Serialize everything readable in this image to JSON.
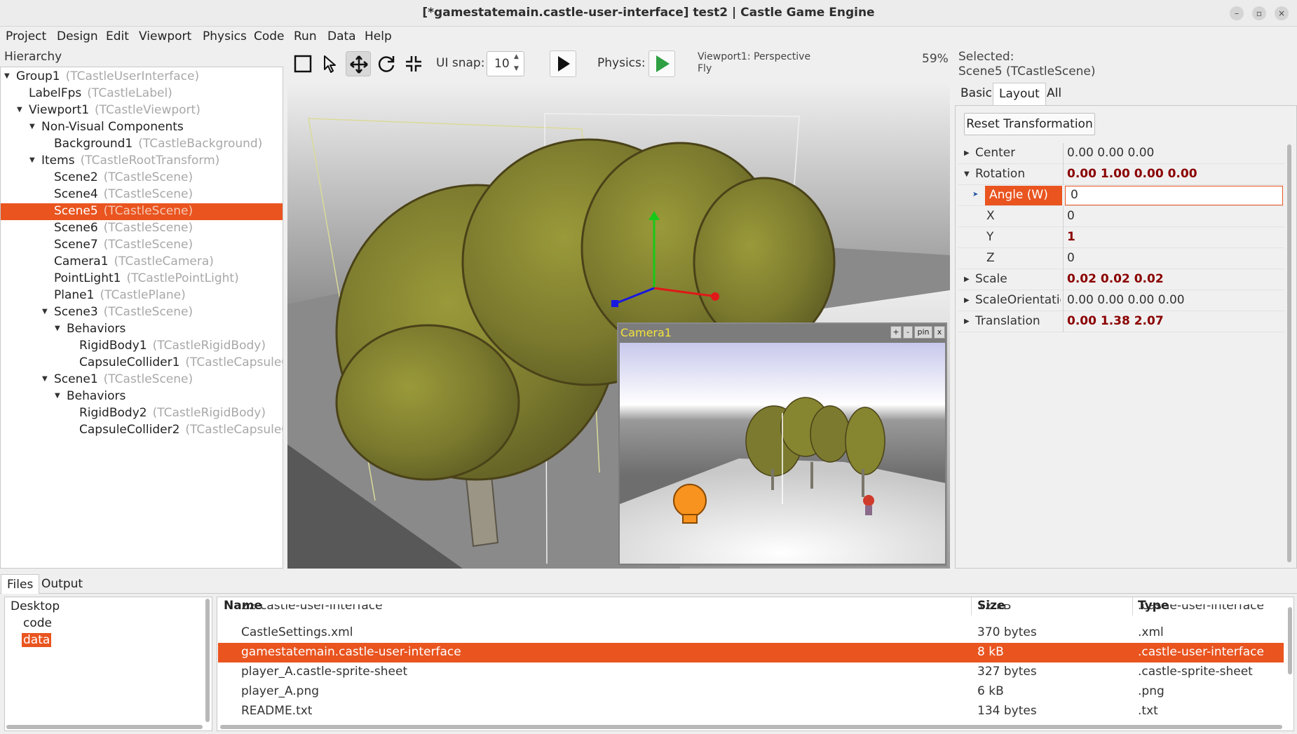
{
  "window": {
    "title": "[*gamestatemain.castle-user-interface] test2 | Castle Game Engine"
  },
  "menubar": [
    "Project",
    "Design",
    "Edit",
    "Viewport",
    "Physics",
    "Code",
    "Run",
    "Data",
    "Help"
  ],
  "hierarchy": {
    "label": "Hierarchy",
    "items": [
      {
        "name": "Group1",
        "cls": "(TCastleUserInterface)"
      },
      {
        "name": "LabelFps",
        "cls": "(TCastleLabel)"
      },
      {
        "name": "Viewport1",
        "cls": "(TCastleViewport)"
      },
      {
        "name": "Non-Visual Components",
        "cls": ""
      },
      {
        "name": "Background1",
        "cls": "(TCastleBackground)"
      },
      {
        "name": "Items",
        "cls": "(TCastleRootTransform)"
      },
      {
        "name": "Scene2",
        "cls": "(TCastleScene)"
      },
      {
        "name": "Scene4",
        "cls": "(TCastleScene)"
      },
      {
        "name": "Scene5",
        "cls": "(TCastleScene)"
      },
      {
        "name": "Scene6",
        "cls": "(TCastleScene)"
      },
      {
        "name": "Scene7",
        "cls": "(TCastleScene)"
      },
      {
        "name": "Camera1",
        "cls": "(TCastleCamera)"
      },
      {
        "name": "PointLight1",
        "cls": "(TCastlePointLight)"
      },
      {
        "name": "Plane1",
        "cls": "(TCastlePlane)"
      },
      {
        "name": "Scene3",
        "cls": "(TCastleScene)"
      },
      {
        "name": "Behaviors",
        "cls": ""
      },
      {
        "name": "RigidBody1",
        "cls": "(TCastleRigidBody)"
      },
      {
        "name": "CapsuleCollider1",
        "cls": "(TCastleCapsuleCo"
      },
      {
        "name": "Scene1",
        "cls": "(TCastleScene)"
      },
      {
        "name": "Behaviors",
        "cls": ""
      },
      {
        "name": "RigidBody2",
        "cls": "(TCastleRigidBody)"
      },
      {
        "name": "CapsuleCollider2",
        "cls": "(TCastleCapsuleCo"
      }
    ]
  },
  "toolbar": {
    "ui_snap_label": "UI snap:",
    "ui_snap_value": "10",
    "physics_label": "Physics:",
    "viewport_info_line1": "Viewport1: Perspective",
    "viewport_info_line2": "Fly",
    "zoom": "59%"
  },
  "camera_preview": {
    "title": "Camera1",
    "buttons": [
      "+",
      "-",
      "pin",
      "x"
    ]
  },
  "properties": {
    "selected_line1": "Selected:",
    "selected_line2": "Scene5 (TCastleScene)",
    "tabs": [
      "Basic",
      "Layout",
      "All"
    ],
    "active_tab": "Layout",
    "reset_button": "Reset Transformation",
    "rows": [
      {
        "name": "Center",
        "value": "0.00 0.00 0.00",
        "modified": false,
        "expander": "right"
      },
      {
        "name": "Rotation",
        "value": "0.00 1.00 0.00 0.00",
        "modified": true,
        "expander": "down"
      },
      {
        "name": "Angle (W)",
        "value": "0",
        "modified": false,
        "expander": "none"
      },
      {
        "name": "X",
        "value": "0",
        "modified": false,
        "expander": "none"
      },
      {
        "name": "Y",
        "value": "1",
        "modified": true,
        "expander": "none"
      },
      {
        "name": "Z",
        "value": "0",
        "modified": false,
        "expander": "none"
      },
      {
        "name": "Scale",
        "value": "0.02 0.02 0.02",
        "modified": true,
        "expander": "right"
      },
      {
        "name": "ScaleOrientation",
        "value": "0.00 0.00 0.00 0.00",
        "modified": false,
        "expander": "right"
      },
      {
        "name": "Translation",
        "value": "0.00 1.38 2.07",
        "modified": true,
        "expander": "right"
      }
    ]
  },
  "bottom": {
    "tabs": [
      "Files",
      "Output"
    ],
    "active_tab": "Files",
    "folders": [
      "Desktop",
      "code",
      "data"
    ],
    "selected_folder": "data",
    "columns": [
      "Name",
      "Size",
      "Type"
    ],
    "files": [
      {
        "name": "22.castle-user-interface",
        "size": "12 kB",
        "type": ".castle-user-interface"
      },
      {
        "name": "CastleSettings.xml",
        "size": "370 bytes",
        "type": ".xml"
      },
      {
        "name": "gamestatemain.castle-user-interface",
        "size": "8 kB",
        "type": ".castle-user-interface"
      },
      {
        "name": "player_A.castle-sprite-sheet",
        "size": "327 bytes",
        "type": ".castle-sprite-sheet"
      },
      {
        "name": "player_A.png",
        "size": "6 kB",
        "type": ".png"
      },
      {
        "name": "README.txt",
        "size": "134 bytes",
        "type": ".txt"
      }
    ],
    "selected_file": "gamestatemain.castle-user-interface"
  },
  "colors": {
    "selection": "#e9541f",
    "modified_value": "#8b0000",
    "camera_title": "#f3e33a",
    "play_green": "#2ea043"
  }
}
